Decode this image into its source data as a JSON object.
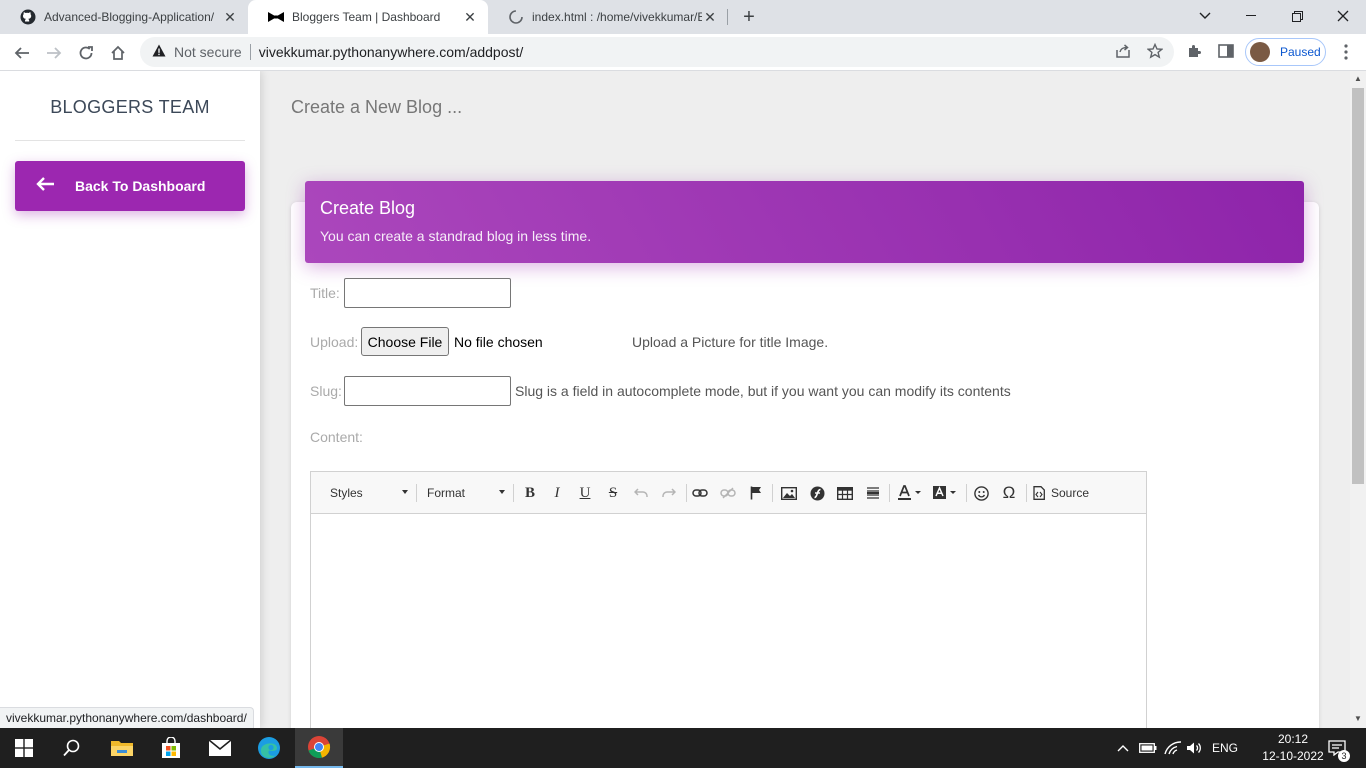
{
  "browser": {
    "tabs": [
      {
        "title": "Advanced-Blogging-Application/",
        "icon": "github-icon",
        "active": false
      },
      {
        "title": "Bloggers Team | Dashboard",
        "icon": "bowtie-icon",
        "active": true
      },
      {
        "title": "index.html : /home/vivekkumar/E",
        "icon": "pythonanywhere-loading-icon",
        "active": false
      }
    ],
    "security_label": "Not secure",
    "url": "vivekkumar.pythonanywhere.com/addpost/",
    "profile_label": "Paused",
    "status_bar_url": "vivekkumar.pythonanywhere.com/dashboard/"
  },
  "sidebar": {
    "brand": "BLOGGERS TEAM",
    "back_button": "Back To Dashboard"
  },
  "page": {
    "heading": "Create a New Blog ..."
  },
  "card": {
    "title": "Create Blog",
    "subtitle": "You can create a standrad blog in less time."
  },
  "form": {
    "title_label": "Title:",
    "title_value": "",
    "upload_label": "Upload:",
    "choose_file": "Choose File",
    "no_file": "No file chosen",
    "upload_hint": "Upload a Picture for title Image.",
    "slug_label": "Slug:",
    "slug_value": "",
    "slug_hint": "Slug is a field in autocomplete mode, but if you want you can modify its contents",
    "content_label": "Content:"
  },
  "editor": {
    "styles": "Styles",
    "format": "Format",
    "source": "Source"
  },
  "taskbar": {
    "language": "ENG",
    "time": "20:12",
    "date": "12-10-2022",
    "notifications": "3"
  },
  "colors": {
    "accent": "#9c27b0",
    "accent_dark": "#8e24aa",
    "page_bg": "#eeeeee"
  }
}
